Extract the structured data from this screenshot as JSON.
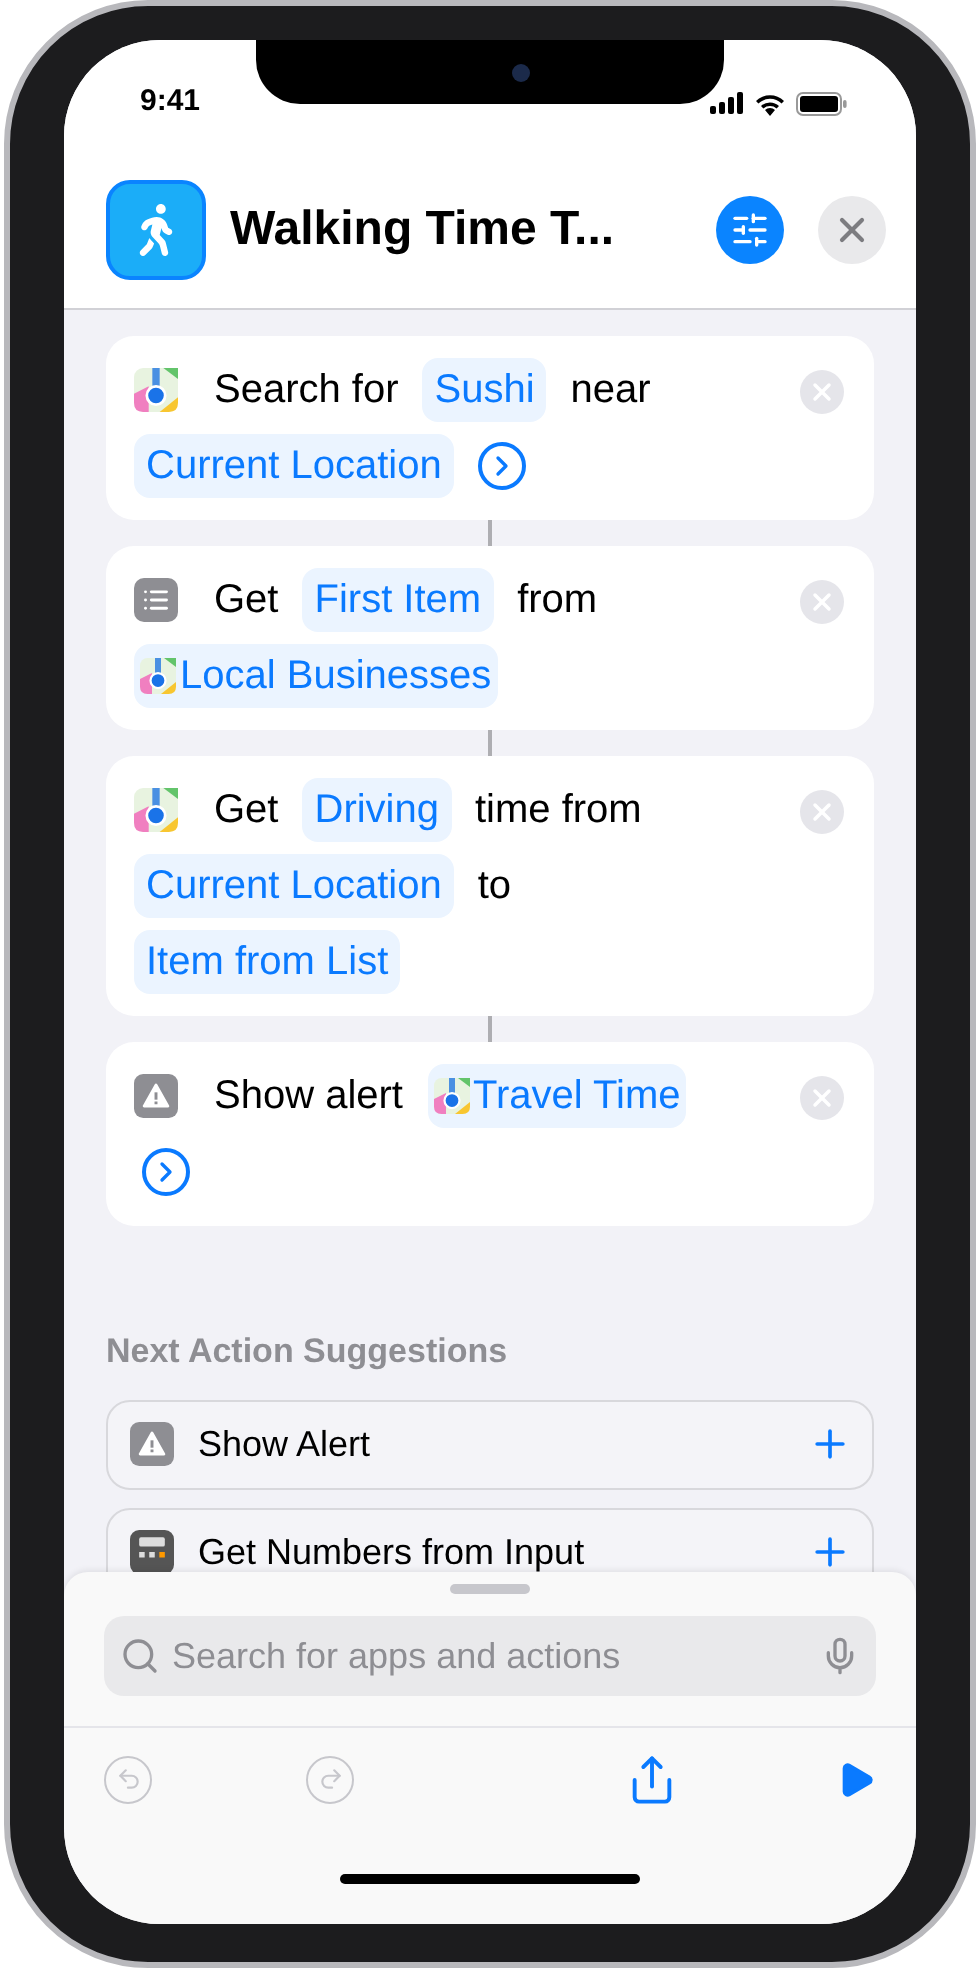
{
  "status_bar": {
    "time": "9:41"
  },
  "header": {
    "title": "Walking Time T..."
  },
  "actions": [
    {
      "kind": "maps",
      "lines": [
        [
          {
            "kind": "text",
            "text": "Search for"
          },
          {
            "kind": "token",
            "text": "Sushi"
          },
          {
            "kind": "text",
            "text": "near"
          }
        ],
        [
          {
            "kind": "token",
            "text": "Current Location"
          },
          {
            "kind": "expand"
          }
        ]
      ]
    },
    {
      "kind": "list",
      "lines": [
        [
          {
            "kind": "text",
            "text": "Get"
          },
          {
            "kind": "token",
            "text": "First Item"
          },
          {
            "kind": "text",
            "text": "from"
          }
        ],
        [
          {
            "kind": "variable",
            "text": "Local Businesses"
          }
        ]
      ]
    },
    {
      "kind": "maps",
      "lines": [
        [
          {
            "kind": "text",
            "text": "Get"
          },
          {
            "kind": "token",
            "text": "Driving"
          },
          {
            "kind": "text",
            "text": "time from"
          }
        ],
        [
          {
            "kind": "token",
            "text": "Current Location"
          },
          {
            "kind": "text",
            "text": "to"
          }
        ],
        [
          {
            "kind": "token",
            "text": "Item from List"
          }
        ]
      ]
    },
    {
      "kind": "alert",
      "lines": [
        [
          {
            "kind": "text",
            "text": "Show alert"
          },
          {
            "kind": "variable",
            "text": "Travel Time"
          }
        ],
        [
          {
            "kind": "expand"
          }
        ]
      ]
    }
  ],
  "suggestions": {
    "title": "Next Action Suggestions",
    "items": [
      {
        "kind": "alert",
        "label": "Show Alert"
      },
      {
        "kind": "calculator",
        "label": "Get Numbers from Input"
      }
    ]
  },
  "search": {
    "placeholder": "Search for apps and actions"
  },
  "toolbar": [
    {
      "kind": "undo",
      "disabled": true
    },
    {
      "kind": "redo",
      "disabled": true
    },
    {
      "kind": "share",
      "disabled": false
    },
    {
      "kind": "run",
      "disabled": false
    }
  ]
}
